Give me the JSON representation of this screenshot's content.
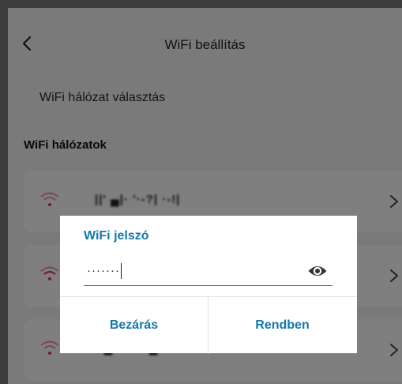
{
  "header": {
    "title": "WiFi beállítás"
  },
  "subtitle": "WiFi hálózat választás",
  "section_title": "WiFi hálózatok",
  "networks": [
    {
      "ssid": "||' ▄|· '·-?| ·-!|",
      "signal_color": "#d93b5b"
    },
    {
      "ssid": "",
      "signal_color": "#d93b5b"
    },
    {
      "ssid": "▀▄▀·.·.▀▄▀·",
      "signal_color": "#d93b5b"
    }
  ],
  "dialog": {
    "title": "WiFi jelszó",
    "password_mask": "·······",
    "close_label": "Bezárás",
    "ok_label": "Rendben"
  },
  "colors": {
    "accent": "#1479a8",
    "wifi_signal": "#d93b5b"
  }
}
